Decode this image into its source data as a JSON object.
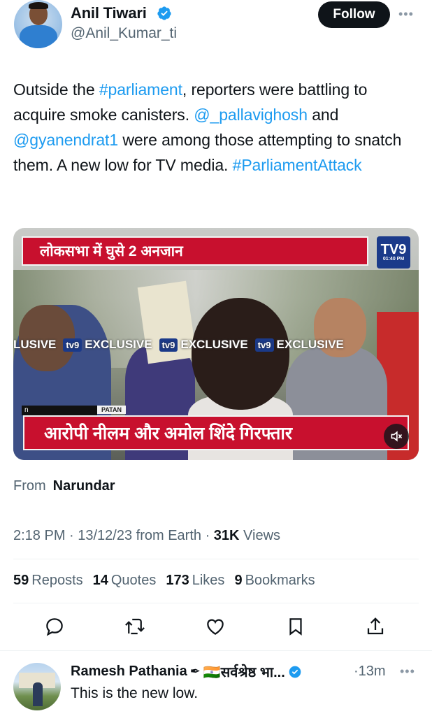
{
  "author": {
    "name": "Anil Tiwari",
    "handle": "@Anil_Kumar_ti",
    "avatar_icon": "profile-photo",
    "follow_label": "Follow",
    "more_icon": "more-horizontal-icon"
  },
  "tweet": {
    "segments": [
      {
        "text": "Outside the ",
        "type": "text"
      },
      {
        "text": "#parliament",
        "type": "link"
      },
      {
        "text": ", reporters were battling to acquire smoke canisters. ",
        "type": "text"
      },
      {
        "text": "@_pallavighosh",
        "type": "link"
      },
      {
        "text": " and ",
        "type": "text"
      },
      {
        "text": "@gyanendrat1",
        "type": "link"
      },
      {
        "text": " were among those attempting to snatch them. A new low for TV media. ",
        "type": "text"
      },
      {
        "text": "#ParliamentAttack",
        "type": "link"
      }
    ]
  },
  "media": {
    "top_banner": "लोकसभा में घुसे 2 अनजान",
    "logo": "TV9",
    "logo_time": "01:40 PM",
    "exclusive_labels": [
      "LUSIVE",
      "EXCLUSIVE",
      "EXCLUSIVE",
      "EXCLUSIVE"
    ],
    "tv9_badge": "tv9",
    "n_box": "n",
    "patan_label": "PATAN",
    "bottom_banner": "आरोपी नीलम और अमोल शिंदे गिरफ्तार",
    "sound_icon": "volume-muted-icon"
  },
  "meta": {
    "from_label": "From",
    "from_value": "Narundar",
    "time": "2:18 PM · 13/12/23 from Earth · ",
    "views_count": "31K",
    "views_label": " Views"
  },
  "stats": [
    {
      "count": "59",
      "label": "Reposts"
    },
    {
      "count": "14",
      "label": "Quotes"
    },
    {
      "count": "173",
      "label": "Likes"
    },
    {
      "count": "9",
      "label": "Bookmarks"
    }
  ],
  "actions": [
    "reply-icon",
    "repost-icon",
    "like-icon",
    "bookmark-icon",
    "share-icon"
  ],
  "reply": {
    "name": "Ramesh Pathania",
    "name_suffix": "🇮🇳सर्वश्रेष्ठ भा...",
    "time": "·13m",
    "text": "This is the new low."
  },
  "colors": {
    "link": "#1d9bf0",
    "text": "#0f1419",
    "secondary": "#536471",
    "banner_red": "#c8102e"
  }
}
